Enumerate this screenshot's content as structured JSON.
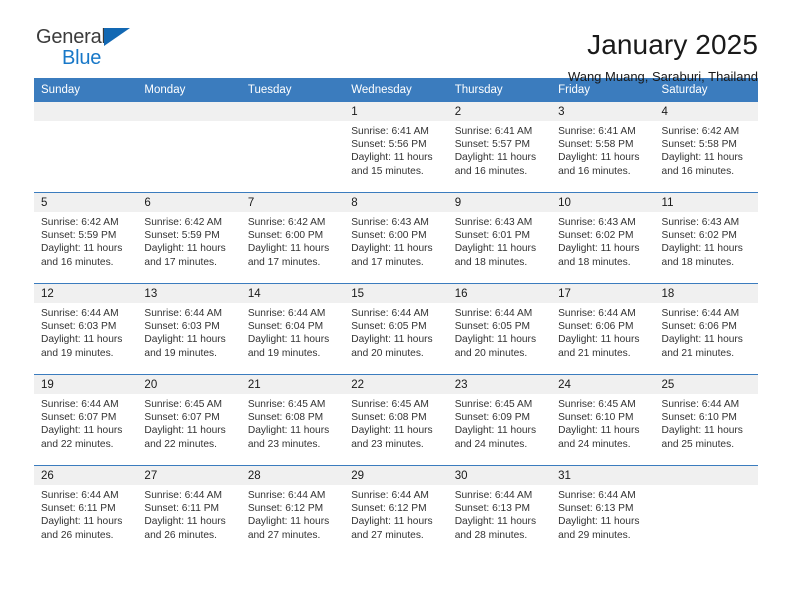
{
  "logo": {
    "word1": "General",
    "word2": "Blue",
    "triangle_color": "#1268b3",
    "text_color": "#3b3b3b",
    "blue_color": "#1878c8"
  },
  "header": {
    "title": "January 2025",
    "subtitle": "Wang Muang, Saraburi, Thailand"
  },
  "theme": {
    "header_blue": "#3b7cbe",
    "daynum_band": "#f0f0f0",
    "text": "#333333"
  },
  "columns": [
    "Sunday",
    "Monday",
    "Tuesday",
    "Wednesday",
    "Thursday",
    "Friday",
    "Saturday"
  ],
  "labels": {
    "sunrise": "Sunrise:",
    "sunset": "Sunset:",
    "daylight": "Daylight:"
  },
  "weeks": [
    [
      {
        "day": "",
        "sunrise": "",
        "sunset": "",
        "daylight_line1": "",
        "daylight_line2": ""
      },
      {
        "day": "",
        "sunrise": "",
        "sunset": "",
        "daylight_line1": "",
        "daylight_line2": ""
      },
      {
        "day": "",
        "sunrise": "",
        "sunset": "",
        "daylight_line1": "",
        "daylight_line2": ""
      },
      {
        "day": "1",
        "sunrise": "Sunrise: 6:41 AM",
        "sunset": "Sunset: 5:56 PM",
        "daylight_line1": "Daylight: 11 hours",
        "daylight_line2": "and 15 minutes."
      },
      {
        "day": "2",
        "sunrise": "Sunrise: 6:41 AM",
        "sunset": "Sunset: 5:57 PM",
        "daylight_line1": "Daylight: 11 hours",
        "daylight_line2": "and 16 minutes."
      },
      {
        "day": "3",
        "sunrise": "Sunrise: 6:41 AM",
        "sunset": "Sunset: 5:58 PM",
        "daylight_line1": "Daylight: 11 hours",
        "daylight_line2": "and 16 minutes."
      },
      {
        "day": "4",
        "sunrise": "Sunrise: 6:42 AM",
        "sunset": "Sunset: 5:58 PM",
        "daylight_line1": "Daylight: 11 hours",
        "daylight_line2": "and 16 minutes."
      }
    ],
    [
      {
        "day": "5",
        "sunrise": "Sunrise: 6:42 AM",
        "sunset": "Sunset: 5:59 PM",
        "daylight_line1": "Daylight: 11 hours",
        "daylight_line2": "and 16 minutes."
      },
      {
        "day": "6",
        "sunrise": "Sunrise: 6:42 AM",
        "sunset": "Sunset: 5:59 PM",
        "daylight_line1": "Daylight: 11 hours",
        "daylight_line2": "and 17 minutes."
      },
      {
        "day": "7",
        "sunrise": "Sunrise: 6:42 AM",
        "sunset": "Sunset: 6:00 PM",
        "daylight_line1": "Daylight: 11 hours",
        "daylight_line2": "and 17 minutes."
      },
      {
        "day": "8",
        "sunrise": "Sunrise: 6:43 AM",
        "sunset": "Sunset: 6:00 PM",
        "daylight_line1": "Daylight: 11 hours",
        "daylight_line2": "and 17 minutes."
      },
      {
        "day": "9",
        "sunrise": "Sunrise: 6:43 AM",
        "sunset": "Sunset: 6:01 PM",
        "daylight_line1": "Daylight: 11 hours",
        "daylight_line2": "and 18 minutes."
      },
      {
        "day": "10",
        "sunrise": "Sunrise: 6:43 AM",
        "sunset": "Sunset: 6:02 PM",
        "daylight_line1": "Daylight: 11 hours",
        "daylight_line2": "and 18 minutes."
      },
      {
        "day": "11",
        "sunrise": "Sunrise: 6:43 AM",
        "sunset": "Sunset: 6:02 PM",
        "daylight_line1": "Daylight: 11 hours",
        "daylight_line2": "and 18 minutes."
      }
    ],
    [
      {
        "day": "12",
        "sunrise": "Sunrise: 6:44 AM",
        "sunset": "Sunset: 6:03 PM",
        "daylight_line1": "Daylight: 11 hours",
        "daylight_line2": "and 19 minutes."
      },
      {
        "day": "13",
        "sunrise": "Sunrise: 6:44 AM",
        "sunset": "Sunset: 6:03 PM",
        "daylight_line1": "Daylight: 11 hours",
        "daylight_line2": "and 19 minutes."
      },
      {
        "day": "14",
        "sunrise": "Sunrise: 6:44 AM",
        "sunset": "Sunset: 6:04 PM",
        "daylight_line1": "Daylight: 11 hours",
        "daylight_line2": "and 19 minutes."
      },
      {
        "day": "15",
        "sunrise": "Sunrise: 6:44 AM",
        "sunset": "Sunset: 6:05 PM",
        "daylight_line1": "Daylight: 11 hours",
        "daylight_line2": "and 20 minutes."
      },
      {
        "day": "16",
        "sunrise": "Sunrise: 6:44 AM",
        "sunset": "Sunset: 6:05 PM",
        "daylight_line1": "Daylight: 11 hours",
        "daylight_line2": "and 20 minutes."
      },
      {
        "day": "17",
        "sunrise": "Sunrise: 6:44 AM",
        "sunset": "Sunset: 6:06 PM",
        "daylight_line1": "Daylight: 11 hours",
        "daylight_line2": "and 21 minutes."
      },
      {
        "day": "18",
        "sunrise": "Sunrise: 6:44 AM",
        "sunset": "Sunset: 6:06 PM",
        "daylight_line1": "Daylight: 11 hours",
        "daylight_line2": "and 21 minutes."
      }
    ],
    [
      {
        "day": "19",
        "sunrise": "Sunrise: 6:44 AM",
        "sunset": "Sunset: 6:07 PM",
        "daylight_line1": "Daylight: 11 hours",
        "daylight_line2": "and 22 minutes."
      },
      {
        "day": "20",
        "sunrise": "Sunrise: 6:45 AM",
        "sunset": "Sunset: 6:07 PM",
        "daylight_line1": "Daylight: 11 hours",
        "daylight_line2": "and 22 minutes."
      },
      {
        "day": "21",
        "sunrise": "Sunrise: 6:45 AM",
        "sunset": "Sunset: 6:08 PM",
        "daylight_line1": "Daylight: 11 hours",
        "daylight_line2": "and 23 minutes."
      },
      {
        "day": "22",
        "sunrise": "Sunrise: 6:45 AM",
        "sunset": "Sunset: 6:08 PM",
        "daylight_line1": "Daylight: 11 hours",
        "daylight_line2": "and 23 minutes."
      },
      {
        "day": "23",
        "sunrise": "Sunrise: 6:45 AM",
        "sunset": "Sunset: 6:09 PM",
        "daylight_line1": "Daylight: 11 hours",
        "daylight_line2": "and 24 minutes."
      },
      {
        "day": "24",
        "sunrise": "Sunrise: 6:45 AM",
        "sunset": "Sunset: 6:10 PM",
        "daylight_line1": "Daylight: 11 hours",
        "daylight_line2": "and 24 minutes."
      },
      {
        "day": "25",
        "sunrise": "Sunrise: 6:44 AM",
        "sunset": "Sunset: 6:10 PM",
        "daylight_line1": "Daylight: 11 hours",
        "daylight_line2": "and 25 minutes."
      }
    ],
    [
      {
        "day": "26",
        "sunrise": "Sunrise: 6:44 AM",
        "sunset": "Sunset: 6:11 PM",
        "daylight_line1": "Daylight: 11 hours",
        "daylight_line2": "and 26 minutes."
      },
      {
        "day": "27",
        "sunrise": "Sunrise: 6:44 AM",
        "sunset": "Sunset: 6:11 PM",
        "daylight_line1": "Daylight: 11 hours",
        "daylight_line2": "and 26 minutes."
      },
      {
        "day": "28",
        "sunrise": "Sunrise: 6:44 AM",
        "sunset": "Sunset: 6:12 PM",
        "daylight_line1": "Daylight: 11 hours",
        "daylight_line2": "and 27 minutes."
      },
      {
        "day": "29",
        "sunrise": "Sunrise: 6:44 AM",
        "sunset": "Sunset: 6:12 PM",
        "daylight_line1": "Daylight: 11 hours",
        "daylight_line2": "and 27 minutes."
      },
      {
        "day": "30",
        "sunrise": "Sunrise: 6:44 AM",
        "sunset": "Sunset: 6:13 PM",
        "daylight_line1": "Daylight: 11 hours",
        "daylight_line2": "and 28 minutes."
      },
      {
        "day": "31",
        "sunrise": "Sunrise: 6:44 AM",
        "sunset": "Sunset: 6:13 PM",
        "daylight_line1": "Daylight: 11 hours",
        "daylight_line2": "and 29 minutes."
      },
      {
        "day": "",
        "sunrise": "",
        "sunset": "",
        "daylight_line1": "",
        "daylight_line2": ""
      }
    ]
  ]
}
